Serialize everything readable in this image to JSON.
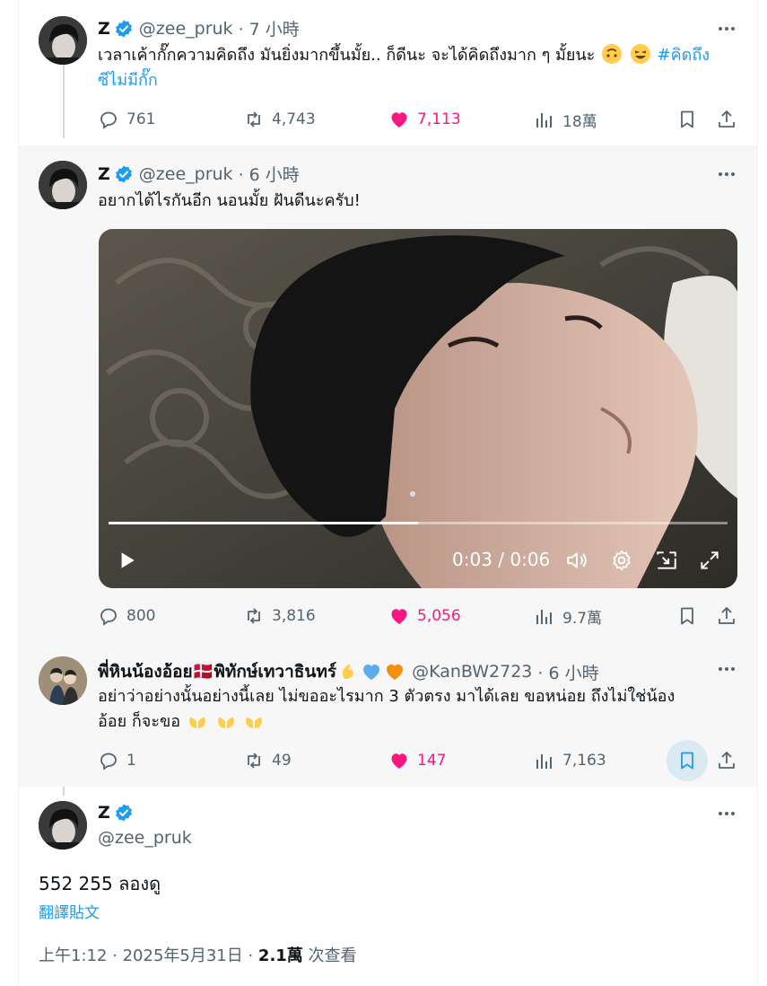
{
  "tweets": [
    {
      "name": "Z",
      "handle": "@zee_pruk",
      "time": "· 7 小時",
      "text": "เวลาเค้ากั๊กความคิดถึง มันยิ่งมากขึ้นมั้ย.. ก็ดีนะ จะได้คิดถึงมาก ๆ มั้ยนะ",
      "emojis": [
        "upside-down-face-emoji",
        "grinning-squinting-face-emoji"
      ],
      "hashtag_line1": "#คิดถึง",
      "hashtag_line2": "ซีไม่มีกั๊ก",
      "stats": {
        "replies": "761",
        "reposts": "4,743",
        "likes": "7,113",
        "views": "18萬"
      }
    },
    {
      "name": "Z",
      "handle": "@zee_pruk",
      "time": "· 6 小時",
      "text": "อยากได้ไรกันอีก นอนมั้ย ฝันดีนะครับ!",
      "video": {
        "time_display": "0:03 / 0:06",
        "progress": 0.5
      },
      "stats": {
        "replies": "800",
        "reposts": "3,816",
        "likes": "5,056",
        "views": "9.7萬"
      }
    },
    {
      "name": "พี่หินน้องอ้อย🇩🇰พิทักษ์เทวาธินทร์",
      "name_emojis": [
        "pinching-hand-emoji",
        "blue-heart-emoji",
        "orange-heart-emoji"
      ],
      "handle": "@KanBW2723",
      "time": "· 6 小時",
      "text_line1": "อย่าว่าอย่างนั้นอย่างนี้เลย ไม่ขออะไรมาก 3 ตัวตรง มาได้เลย  ขอหน่อย ถึงไม่ใช่น้อง",
      "text_line2": "อ้อย ก็จะขอ",
      "text_emojis": [
        "palms-up-emoji",
        "palms-up-emoji",
        "palms-up-emoji"
      ],
      "stats": {
        "replies": "1",
        "reposts": "49",
        "likes": "147",
        "views": "7,163"
      }
    }
  ],
  "main": {
    "name": "Z",
    "handle": "@zee_pruk",
    "text": "552 255 ลองดู",
    "translate": "翻譯貼文",
    "timestamp": "上午1:12 · 2025年5月31日 · ",
    "views_count": "2.1萬",
    "views_label": " 次查看"
  },
  "colors": {
    "like": "#f91880",
    "link": "#1d9bf0",
    "muted": "#536471",
    "verified": "#1d9bf0"
  }
}
